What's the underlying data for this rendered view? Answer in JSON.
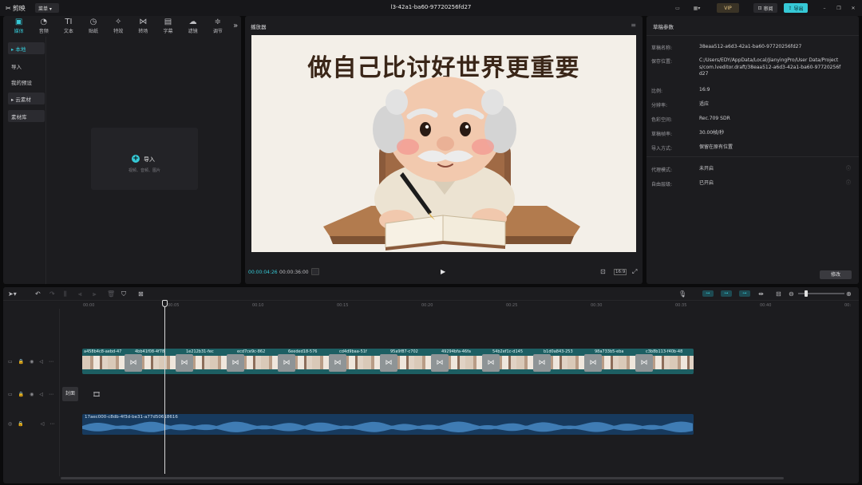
{
  "titlebar": {
    "app_name": "剪映",
    "menu_label": "菜单",
    "project_title": "l3-42a1-ba60-97720256fd27",
    "vip_label": "VIP",
    "review_label": "审阅",
    "export_label": "导出"
  },
  "toolbar": {
    "tools": [
      {
        "label": "媒体",
        "icon": "media-icon",
        "glyph": "▣"
      },
      {
        "label": "音频",
        "icon": "audio-icon",
        "glyph": "◔"
      },
      {
        "label": "文本",
        "icon": "text-icon",
        "glyph": "TI"
      },
      {
        "label": "贴纸",
        "icon": "sticker-icon",
        "glyph": "◷"
      },
      {
        "label": "特效",
        "icon": "effects-icon",
        "glyph": "✧"
      },
      {
        "label": "转场",
        "icon": "transition-icon",
        "glyph": "⋈"
      },
      {
        "label": "字幕",
        "icon": "subtitle-icon",
        "glyph": "▤"
      },
      {
        "label": "滤镜",
        "icon": "filter-icon",
        "glyph": "☁"
      },
      {
        "label": "调节",
        "icon": "adjust-icon",
        "glyph": "≑"
      }
    ],
    "more_glyph": "»"
  },
  "sidenav": {
    "items": [
      "▸ 本地",
      "导入",
      "我的预设",
      "▸ 云素材",
      "素材库"
    ]
  },
  "import": {
    "label": "导入",
    "sub": "视频、音频、图片"
  },
  "player": {
    "header": "播放器",
    "caption": "做自己比讨好世界更重要",
    "current_time": "00:00:04:26",
    "total_time": "00:00:36:00",
    "ratio_label": "16:9"
  },
  "props": {
    "header": "草稿参数",
    "rows": [
      {
        "k": "草稿名称:",
        "v": "38eaa512-a6d3-42a1-ba60-97720256fd27"
      },
      {
        "k": "保存位置:",
        "v": "C:/Users/EDY/AppData/Local/JianyingPro/User Data/Projects/com.lveditor.draft/38eaa512-a6d3-42a1-ba60-97720256fd27"
      },
      {
        "k": "比例:",
        "v": "16:9"
      },
      {
        "k": "分辨率:",
        "v": "适应"
      },
      {
        "k": "色彩空间:",
        "v": "Rec.709 SDR"
      },
      {
        "k": "草稿帧率:",
        "v": "30.00帧/秒"
      },
      {
        "k": "导入方式:",
        "v": "保留在原有位置"
      },
      {
        "k": "代理模式:",
        "v": "未开启"
      },
      {
        "k": "自由层级:",
        "v": "已开启"
      }
    ],
    "modify_label": "修改"
  },
  "timeline": {
    "ticks": [
      "00:00",
      "00:05",
      "00:10",
      "00:15",
      "00:20",
      "00:25",
      "00:30",
      "00:35",
      "00:40",
      "00:"
    ],
    "clips": [
      "a458b4c8-aebd-47",
      "4bb41f08-4f78",
      "1e212b31-fec",
      "ecd7ce9c-862",
      "6eeded18-576",
      "cd4d9baa-51f",
      "95a9f87-c702",
      "49294bfa-46fa",
      "54b2ef1c-d145",
      "b1d0a843-253",
      "98a733b5-eba",
      "c3b8b113-f40b-48"
    ],
    "cover_label": "封面",
    "audio_name": "17aec000-c8db-4f3d-be31-a77d50618616"
  },
  "colors": {
    "accent": "#36c9d6",
    "video_track": "#1d5f63",
    "audio_track": "#173a5e"
  }
}
